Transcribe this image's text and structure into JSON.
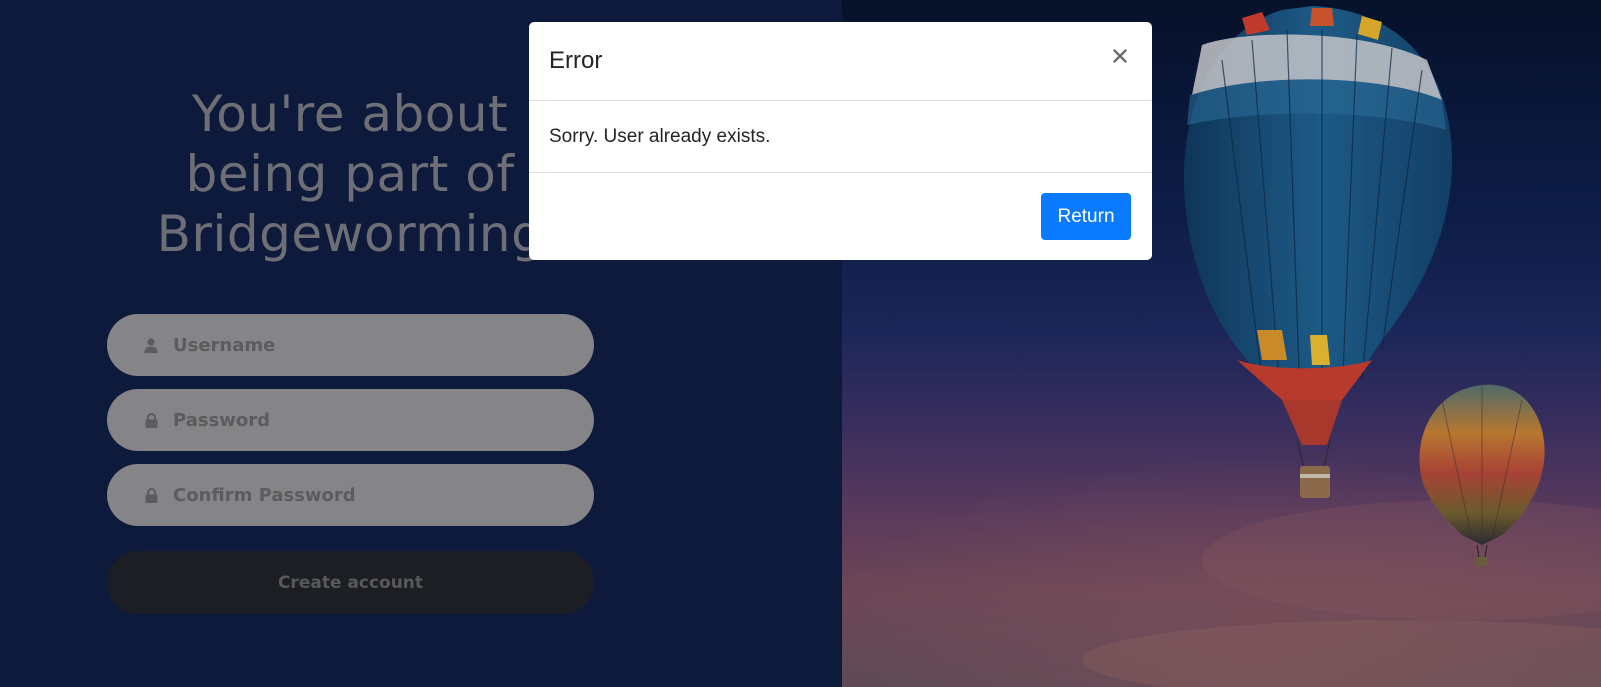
{
  "signup": {
    "headline_lines": [
      "You're about",
      "being part of",
      "Bridgeworming"
    ],
    "username_placeholder": "Username",
    "password_placeholder": "Password",
    "confirm_password_placeholder": "Confirm Password",
    "create_account_label": "Create account",
    "icons": {
      "username": "user-icon",
      "password": "lock-icon",
      "confirm_password": "lock-icon"
    }
  },
  "modal": {
    "title": "Error",
    "message": "Sorry. User already exists.",
    "close_icon": "close-icon",
    "return_label": "Return"
  },
  "colors": {
    "primary_button": "#0a7bff",
    "left_background": "#0e1a3c"
  }
}
